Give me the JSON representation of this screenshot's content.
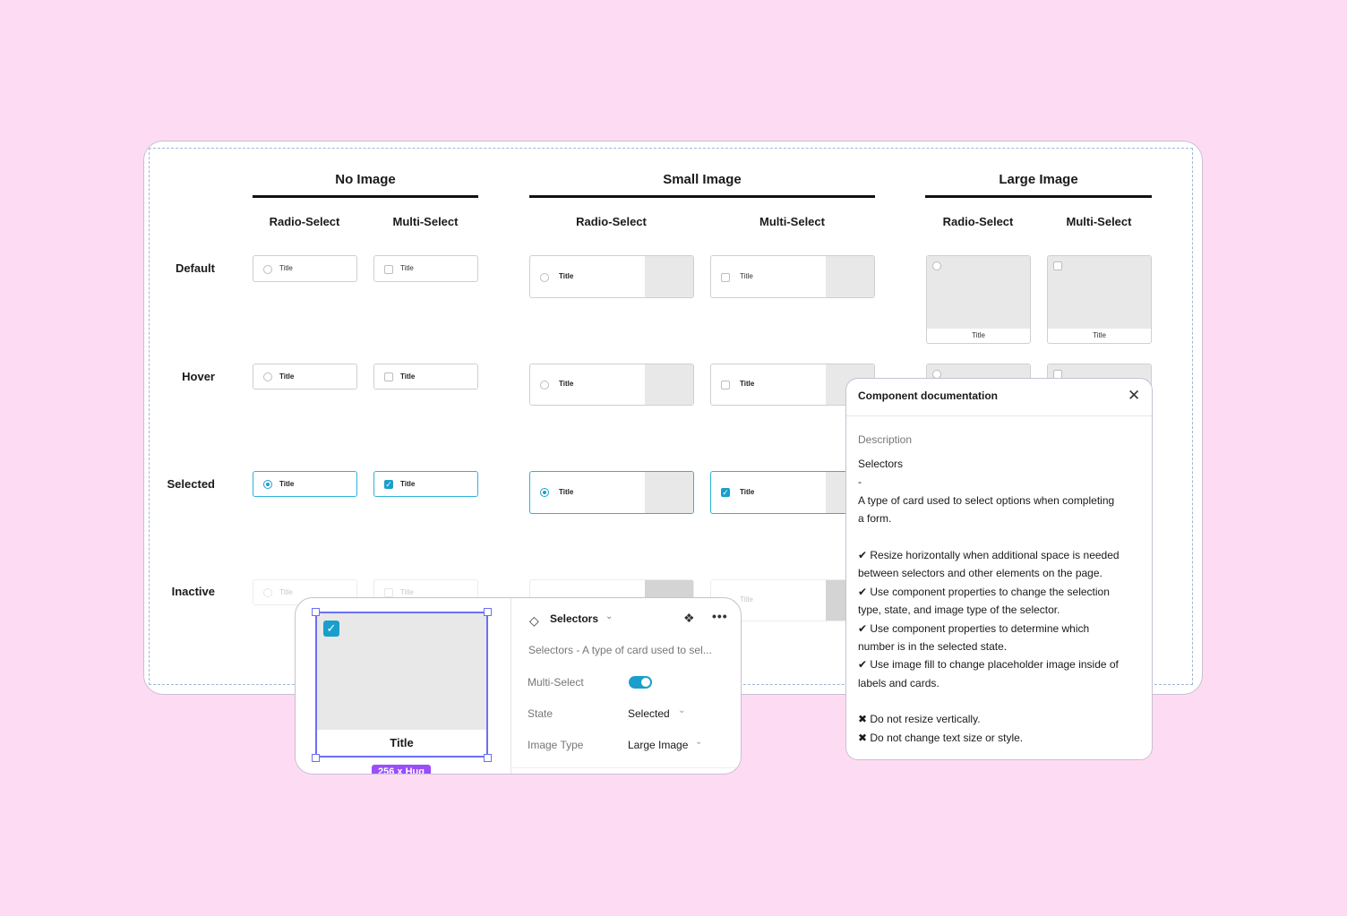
{
  "groups": [
    {
      "title": "No Image"
    },
    {
      "title": "Small Image"
    },
    {
      "title": "Large Image"
    }
  ],
  "column_labels": {
    "radio": "Radio-Select",
    "multi": "Multi-Select"
  },
  "row_labels": [
    "Default",
    "Hover",
    "Selected",
    "Inactive"
  ],
  "card_title": "Title",
  "colors": {
    "background": "#fddcf3",
    "accent": "#1a9fcc",
    "selection": "#6b6ff5",
    "size_badge": "#9b4dfa"
  },
  "panel": {
    "title": "Selectors",
    "description": "Selectors - A type of card used to sel...",
    "preview_title": "Title",
    "size_badge": "256 x Hug",
    "props": [
      {
        "label": "Multi-Select",
        "value": ""
      },
      {
        "label": "State",
        "value": "Selected"
      },
      {
        "label": "Image Type",
        "value": "Large Image"
      }
    ],
    "multi_select_on": true
  },
  "doc": {
    "title": "Component documentation",
    "section": "Description",
    "lines": [
      "Selectors",
      "-",
      "A type of card used to select options when completing",
      "a form.",
      "",
      "✔ Resize horizontally when additional space is needed",
      "between selectors and other elements on the page.",
      "✔ Use component properties to change the selection",
      "type, state, and image type of the selector.",
      "✔ Use component properties to determine which",
      "number is in the selected state.",
      "✔ Use image fill to change placeholder image inside of",
      "labels and cards.",
      "",
      "✖ Do not resize vertically.",
      "✖ Do not change text size or style."
    ]
  }
}
